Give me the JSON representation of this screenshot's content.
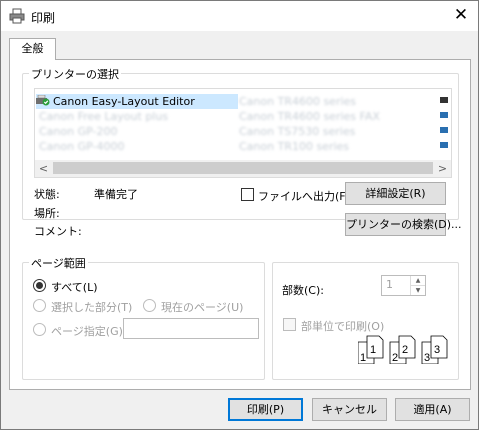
{
  "window": {
    "title": "印刷",
    "close_glyph": "✕"
  },
  "tabs": [
    {
      "label": "全般",
      "selected": true
    }
  ],
  "printer_select": {
    "group_label": "プリンターの選択",
    "printers": [
      {
        "name": "Canon Easy-Layout Editor",
        "selected": true
      },
      {
        "name": "Canon Free Layout plus",
        "blurred": true
      },
      {
        "name": "Canon GP-200",
        "blurred": true
      },
      {
        "name": "Canon GP-4000",
        "blurred": true
      },
      {
        "name": "Canon TR4600 series",
        "blurred": true
      },
      {
        "name": "Canon TR4600 series FAX",
        "blurred": true
      },
      {
        "name": "Canon TS7530 series",
        "blurred": true
      },
      {
        "name": "Canon TR100 series",
        "blurred": true
      }
    ],
    "scroll_left": "<",
    "scroll_right": ">"
  },
  "status": {
    "status_label": "状態:",
    "status_value": "準備完了",
    "location_label": "場所:",
    "comment_label": "コメント:",
    "print_to_file_label": "ファイルへ出力(F)",
    "print_to_file_checked": false,
    "preferences_button": "詳細設定(R)",
    "find_printer_button": "プリンターの検索(D)..."
  },
  "page_range": {
    "group_label": "ページ範囲",
    "all_label": "すべて(L)",
    "selection_label": "選択した部分(T)",
    "current_page_label": "現在のページ(U)",
    "pages_label": "ページ指定(G):",
    "pages_value": "",
    "selected_option": "all"
  },
  "copies": {
    "copies_label": "部数(C):",
    "copies_value": "1",
    "collate_label": "部単位で印刷(O)",
    "collate_checked": false,
    "collate_pages": [
      "1",
      "1",
      "2",
      "2",
      "3",
      "3"
    ]
  },
  "footer": {
    "print_button": "印刷(P)",
    "cancel_button": "キャンセル",
    "apply_button": "適用(A)"
  }
}
